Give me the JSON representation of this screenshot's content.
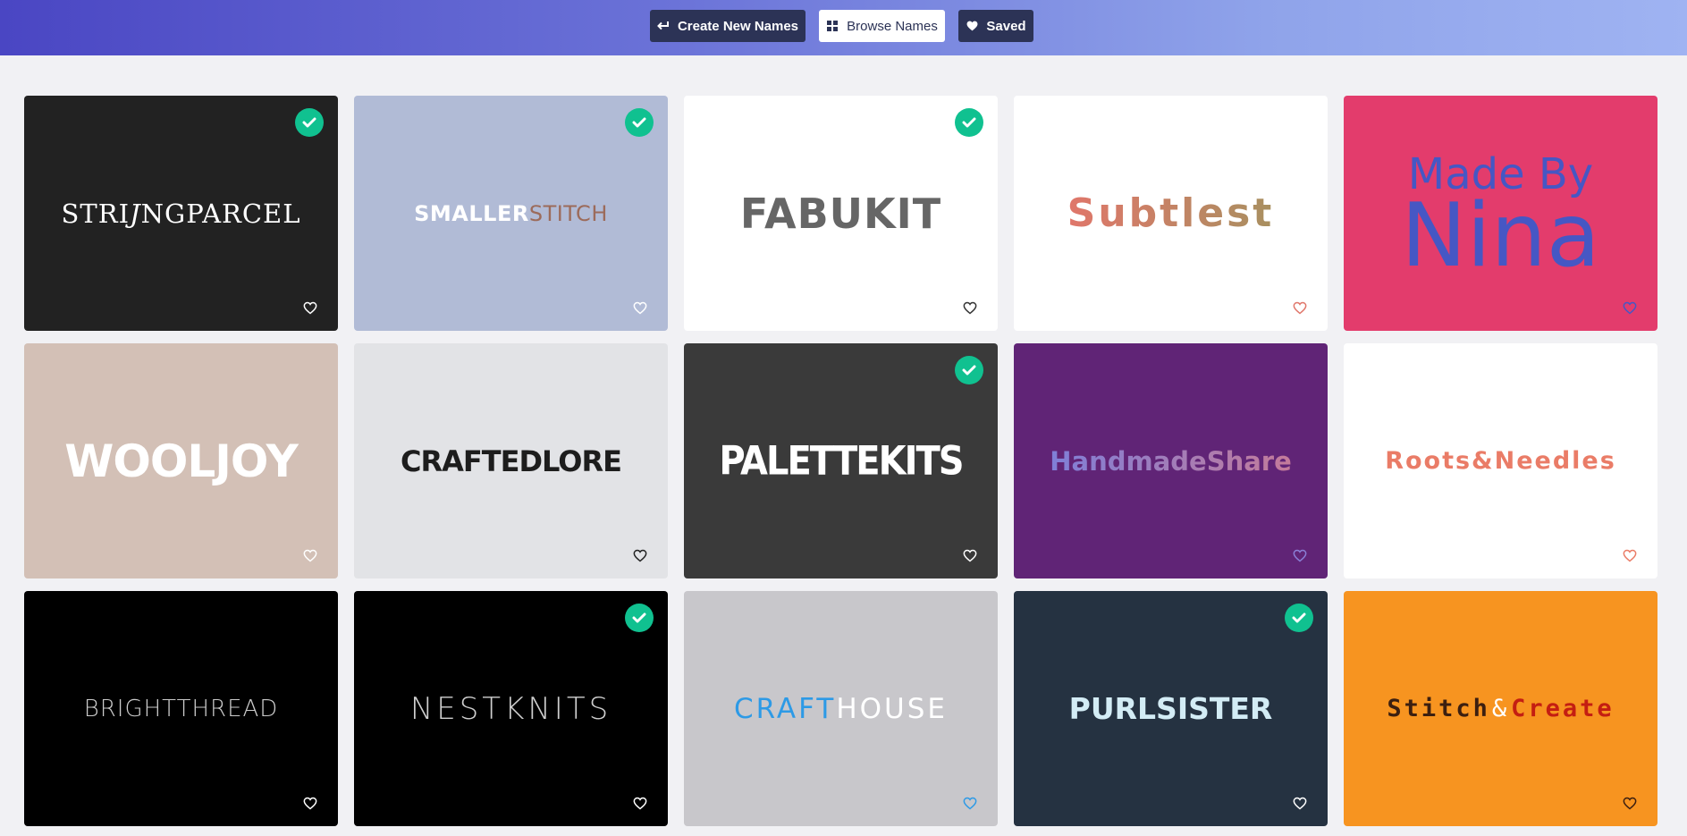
{
  "nav": {
    "create_label": "Create New Names",
    "browse_label": "Browse Names",
    "saved_label": "Saved"
  },
  "cards": [
    {
      "name_a": "STRI",
      "name_b": "J",
      "name_c": "NGPARCEL",
      "bg": "#222222",
      "fg": "#ffffff",
      "fg2": "#ffffff",
      "heart": "#ffffff",
      "checked": true
    },
    {
      "name_a": "SMALLER",
      "name_b": "STITCH",
      "bg": "#b1bbd6",
      "fg": "#ffffff",
      "fg2": "#9c6b5b",
      "heart": "#ffffff",
      "checked": true
    },
    {
      "name_a": "FABUKIT",
      "bg": "#ffffff",
      "fg": "#666666",
      "heart": "#333333",
      "checked": true
    },
    {
      "name_a": "Subtlest",
      "bg": "#ffffff",
      "fg": "#e0766a",
      "fg2": "#a89060",
      "heart": "#e0766a",
      "checked": false
    },
    {
      "name_a": "Made By",
      "name_b": "Nina",
      "bg": "#e33c6c",
      "fg": "#4657c4",
      "heart": "#4657c4",
      "checked": false
    },
    {
      "name_a": "WOOLJOY",
      "bg": "#d3c0b6",
      "fg": "#ffffff",
      "heart": "#ffffff",
      "checked": false
    },
    {
      "name_a": "CRAFTEDLORE",
      "bg": "#e2e3e6",
      "fg": "#1d1d1d",
      "heart": "#222222",
      "checked": false
    },
    {
      "name_a": "PALETTEKITS",
      "bg": "#3a3a3a",
      "fg": "#ffffff",
      "heart": "#ffffff",
      "checked": true
    },
    {
      "name_a": "HandmadeShare",
      "bg": "#602476",
      "fg": "#7f7fd8",
      "fg2": "#c47b9a",
      "heart": "#8a7fd6",
      "checked": false
    },
    {
      "name_a": "Roots&Needles",
      "bg": "#ffffff",
      "fg": "#ea7c67",
      "heart": "#ea7c67",
      "checked": false
    },
    {
      "name_a": "BRIGHTTHREAD",
      "bg": "#000000",
      "fg": "#cccccc",
      "heart": "#ffffff",
      "checked": false
    },
    {
      "name_a": "NESTKNITS",
      "bg": "#000000",
      "fg": "#cfcfcf",
      "heart": "#ffffff",
      "checked": true
    },
    {
      "name_a": "CRAFT",
      "name_b": "HOUSE",
      "bg": "#c8c7cb",
      "fg": "#2d9ae6",
      "fg2": "#ffffff",
      "heart": "#2d9ae6",
      "checked": false
    },
    {
      "name_a": "PURLSISTER",
      "bg": "#253241",
      "fg": "#d3ecf5",
      "heart": "#ffffff",
      "checked": true
    },
    {
      "name_a": "Stitch",
      "name_b": "&",
      "name_c": "Create",
      "bg": "#f79420",
      "fg": "#3c1f10",
      "fg2": "#ffffff",
      "fg3": "#c41e12",
      "heart": "#3c1f10",
      "checked": false
    }
  ],
  "colors": {
    "accent_check": "#10c190",
    "nav_dark": "#2c3356"
  },
  "icons": {
    "create": "arrow-left-icon",
    "browse": "grid-icon",
    "saved": "heart-icon",
    "selected": "check-icon",
    "favorite": "heart-outline-icon"
  }
}
